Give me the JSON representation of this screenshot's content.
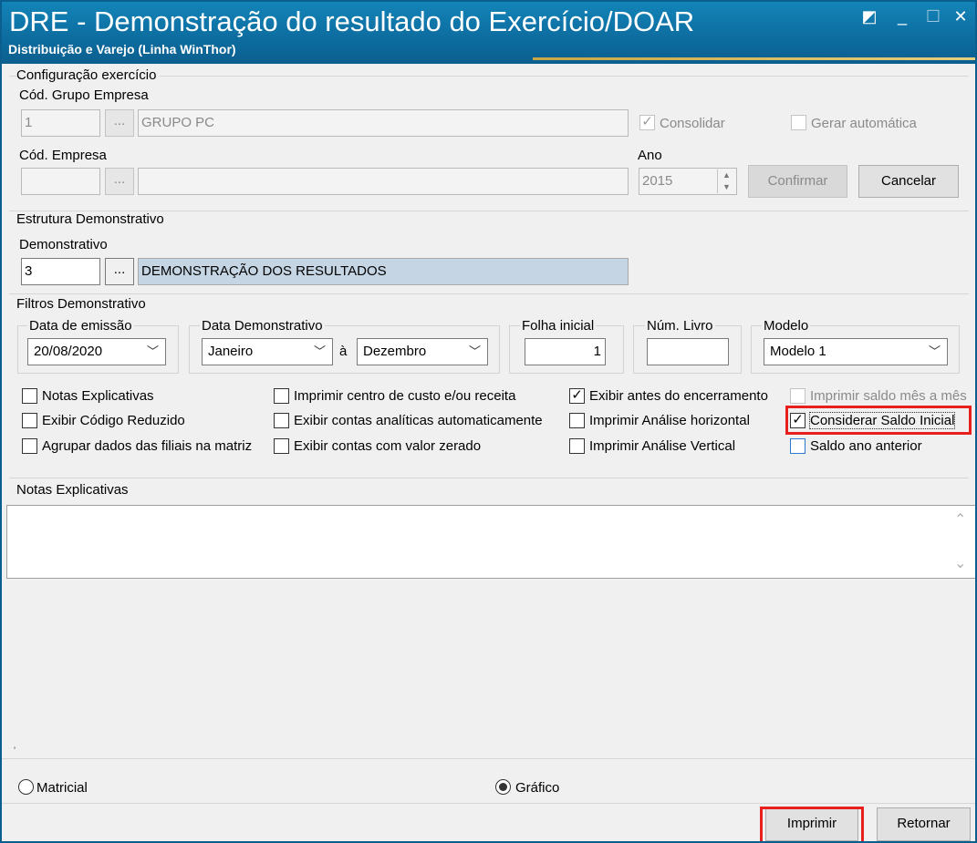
{
  "window": {
    "title": "DRE - Demonstração do resultado do Exercício/DOAR",
    "subtitle": "Distribuição e Varejo (Linha WinThor)",
    "controls": {
      "restore": "◩",
      "minimize": "_",
      "maximize": "☐",
      "close": "✕"
    }
  },
  "config": {
    "legend": "Configuração exercício",
    "grupo_label": "Cód. Grupo Empresa",
    "grupo_code": "1",
    "grupo_lookup": "...",
    "grupo_name": "GRUPO PC",
    "consolidar_label": "Consolidar",
    "consolidar_checked": true,
    "gerar_label": "Gerar automática",
    "gerar_checked": false,
    "empresa_label": "Cód. Empresa",
    "empresa_code": "",
    "empresa_lookup": "...",
    "empresa_name": "",
    "ano_label": "Ano",
    "ano_value": "2015",
    "confirmar_label": "Confirmar",
    "cancelar_label": "Cancelar"
  },
  "estrutura": {
    "legend": "Estrutura Demonstrativo",
    "demonstrativo_label": "Demonstrativo",
    "demonstrativo_code": "3",
    "demonstrativo_lookup": "...",
    "demonstrativo_name": "DEMONSTRAÇÃO DOS RESULTADOS"
  },
  "filtros": {
    "legend": "Filtros Demonstrativo",
    "data_emissao_label": "Data de emissão",
    "data_emissao_value": "20/08/2020",
    "data_demonstrativo_label": "Data Demonstrativo",
    "mes_inicio": "Janeiro",
    "separator": "à",
    "mes_fim": "Dezembro",
    "folha_label": "Folha inicial",
    "folha_value": "1",
    "num_livro_label": "Núm. Livro",
    "num_livro_value": "",
    "modelo_label": "Modelo",
    "modelo_value": "Modelo 1"
  },
  "checkboxes": [
    {
      "label": "Notas Explicativas",
      "checked": false
    },
    {
      "label": "Exibir Código Reduzido",
      "checked": false
    },
    {
      "label": "Agrupar dados das filiais na matriz",
      "checked": false
    },
    {
      "label": "Imprimir centro de custo e/ou receita",
      "checked": false
    },
    {
      "label": "Exibir contas analíticas automaticamente",
      "checked": false
    },
    {
      "label": "Exibir contas com valor zerado",
      "checked": false
    },
    {
      "label": "Exibir antes do encerramento",
      "checked": true
    },
    {
      "label": "Imprimir Análise horizontal",
      "checked": false
    },
    {
      "label": "Imprimir Análise Vertical",
      "checked": false
    },
    {
      "label": "Imprimir saldo mês a mês",
      "checked": false,
      "disabled": true
    },
    {
      "label": "Considerar Saldo Inicial",
      "checked": true
    },
    {
      "label": "Saldo ano anterior",
      "checked": false
    }
  ],
  "notas": {
    "legend": "Notas Explicativas",
    "text": "",
    "scroll_up": "⌃",
    "scroll_down": "⌄"
  },
  "bottom": {
    "marker": "'",
    "radio_matricial": "Matricial",
    "radio_grafico": "Gráfico",
    "selected": "Gráfico",
    "imprimir_label": "Imprimir",
    "retornar_label": "Retornar"
  },
  "colors": {
    "titlebar": "#0d6c9f",
    "highlight": "#e8201d",
    "accent_line": "#c9a646"
  }
}
